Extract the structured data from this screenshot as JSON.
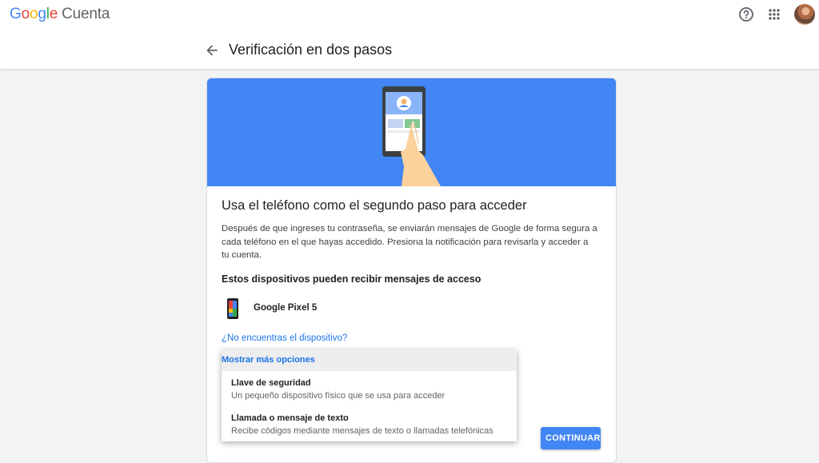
{
  "app": {
    "logo_letters": [
      "G",
      "o",
      "o",
      "g",
      "l",
      "e"
    ],
    "product": "Cuenta"
  },
  "header": {
    "title": "Verificación en dos pasos"
  },
  "card": {
    "heading": "Usa el teléfono como el segundo paso para acceder",
    "description": "Después de que ingreses tu contraseña, se enviarán mensajes de Google de forma segura a cada teléfono en el que hayas accedido. Presiona la notificación para revisarla y acceder a tu cuenta.",
    "devices_heading": "Estos dispositivos pueden recibir mensajes de acceso",
    "devices": [
      {
        "name": "Google Pixel 5",
        "icon": "smartphone-icon"
      }
    ],
    "not_found_link": "¿No encuentras el dispositivo?",
    "continue_label": "CONTINUAR"
  },
  "menu": {
    "header": "Mostrar más opciones",
    "items": [
      {
        "title": "Llave de seguridad",
        "subtitle": "Un pequeño dispositivo físico que se usa para acceder"
      },
      {
        "title": "Llamada o mensaje de texto",
        "subtitle": "Recibe códigos mediante mensajes de texto o llamadas telefónicas"
      }
    ]
  },
  "colors": {
    "accent": "#1a73e8",
    "hero_background": "#4285f4",
    "button": "#4285f4"
  },
  "icons": [
    "help-icon",
    "apps-grid-icon",
    "avatar",
    "back-arrow-icon",
    "smartphone-icon",
    "phone-tap-illustration"
  ]
}
